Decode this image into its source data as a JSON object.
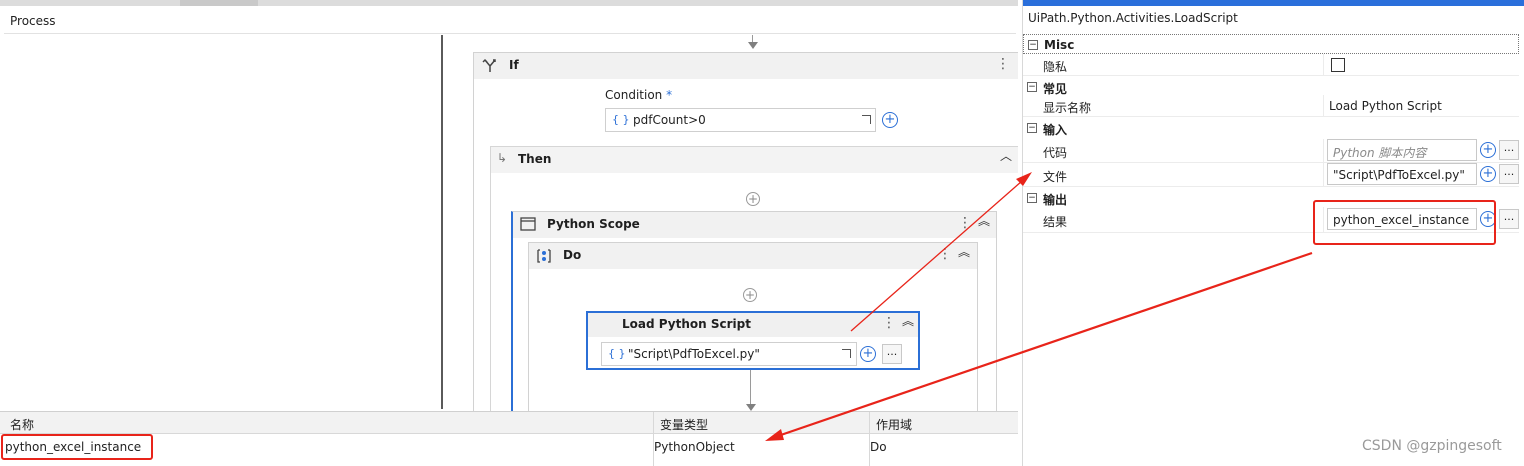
{
  "breadcrumb": "Process",
  "if_activity": {
    "title": "If",
    "condition_label": "Condition",
    "required_mark": "*",
    "condition_value": "pdfCount>0",
    "then_label": "Then"
  },
  "python_scope": {
    "title": "Python Scope"
  },
  "do_sequence": {
    "title": "Do"
  },
  "load_script": {
    "title": "Load Python Script",
    "file_value": "\"Script\\PdfToExcel.py\"",
    "dots": "..."
  },
  "variables": {
    "headers": [
      "名称",
      "变量类型",
      "作用域"
    ],
    "rows": [
      {
        "name": "python_excel_instance",
        "type": "PythonObject",
        "scope": "Do"
      }
    ]
  },
  "properties": {
    "class_name": "UiPath.Python.Activities.LoadScript",
    "misc": {
      "category": "Misc",
      "private_label": "隐私",
      "private_checked": false
    },
    "common": {
      "category": "常见",
      "display_name_label": "显示名称",
      "display_name_value": "Load Python Script"
    },
    "input": {
      "category": "输入",
      "code_label": "代码",
      "code_placeholder": "Python 脚本内容",
      "file_label": "文件",
      "file_value": "\"Script\\PdfToExcel.py\""
    },
    "output": {
      "category": "输出",
      "result_label": "结果",
      "result_value": "python_excel_instance"
    },
    "dots": "..."
  },
  "watermark": "CSDN @gzpingesoft",
  "colors": {
    "accent": "#2a6fdb",
    "annotation": "#e8241a"
  }
}
